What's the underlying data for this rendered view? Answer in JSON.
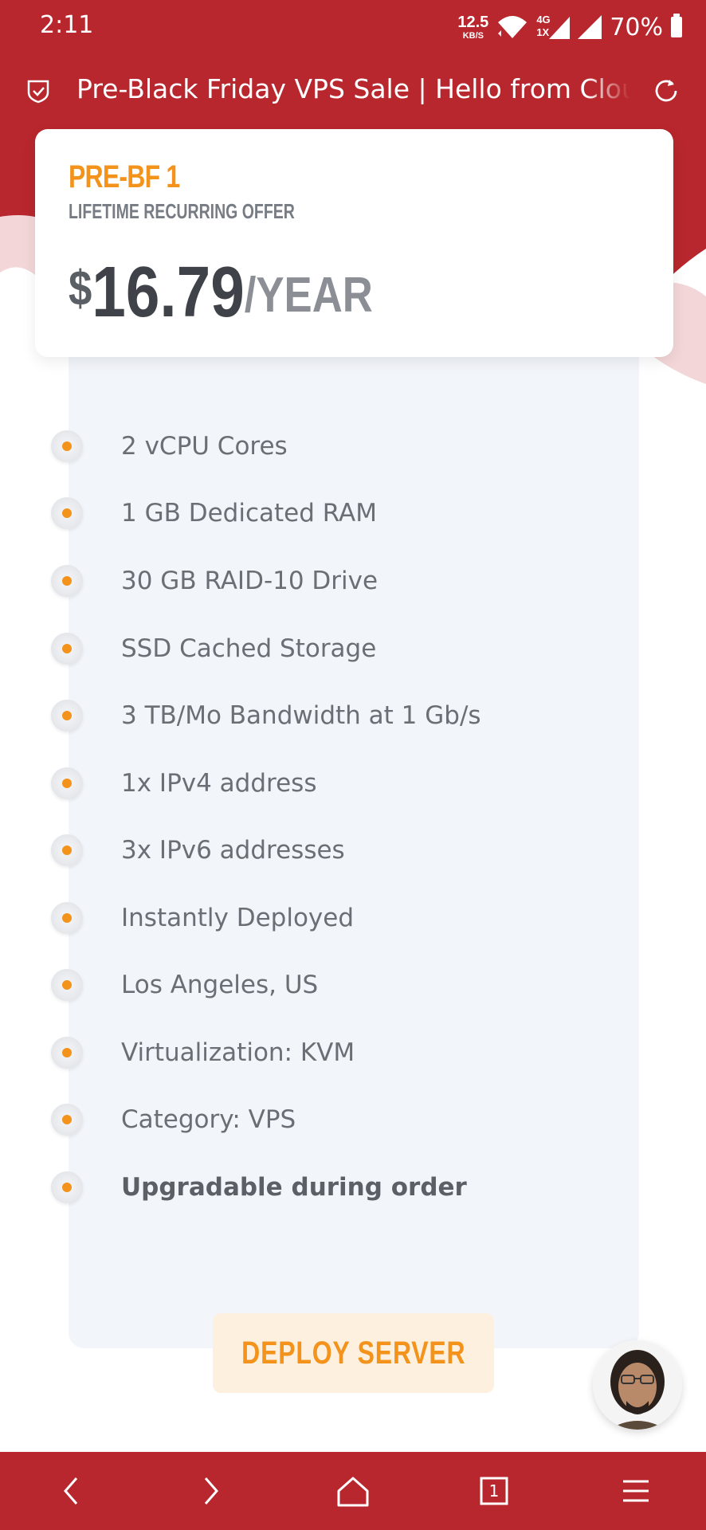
{
  "status_bar": {
    "time": "2:11",
    "net_speed_value": "12.5",
    "net_speed_unit": "KB/S",
    "network_label_top": "4G",
    "network_label_bottom": "1X",
    "battery_percent": "70%"
  },
  "browser": {
    "page_title": "Pre-Black Friday VPS Sale | Hello from CloudCone"
  },
  "plan": {
    "name": "PRE-BF 1",
    "subtitle": "LIFETIME RECURRING OFFER",
    "currency": "$",
    "price": "16.79",
    "period": "/YEAR"
  },
  "features": [
    {
      "text": "2 vCPU Cores",
      "bold": false
    },
    {
      "text": "1 GB Dedicated RAM",
      "bold": false
    },
    {
      "text": "30 GB RAID-10 Drive",
      "bold": false
    },
    {
      "text": "SSD Cached Storage",
      "bold": false
    },
    {
      "text": "3 TB/Mo Bandwidth at 1 Gb/s",
      "bold": false
    },
    {
      "text": "1x IPv4 address",
      "bold": false
    },
    {
      "text": "3x IPv6 addresses",
      "bold": false
    },
    {
      "text": "Instantly Deployed",
      "bold": false
    },
    {
      "text": "Los Angeles, US",
      "bold": false
    },
    {
      "text": "Virtualization: KVM",
      "bold": false
    },
    {
      "text": "Category: VPS",
      "bold": false
    },
    {
      "text": "Upgradable during order",
      "bold": true
    }
  ],
  "deploy_button": {
    "label": "DEPLOY SERVER"
  },
  "bottom_nav": {
    "tab_count": "1"
  },
  "colors": {
    "brand_red": "#b8272d",
    "accent_orange": "#f3931c",
    "panel_bg": "#f2f5fa",
    "button_bg": "#fdf0df"
  },
  "icons": {
    "shield": "shield-check-icon",
    "reload": "reload-icon",
    "back": "chevron-left-icon",
    "forward": "chevron-right-icon",
    "home": "home-icon",
    "tabs": "tabs-icon",
    "menu": "menu-icon"
  }
}
